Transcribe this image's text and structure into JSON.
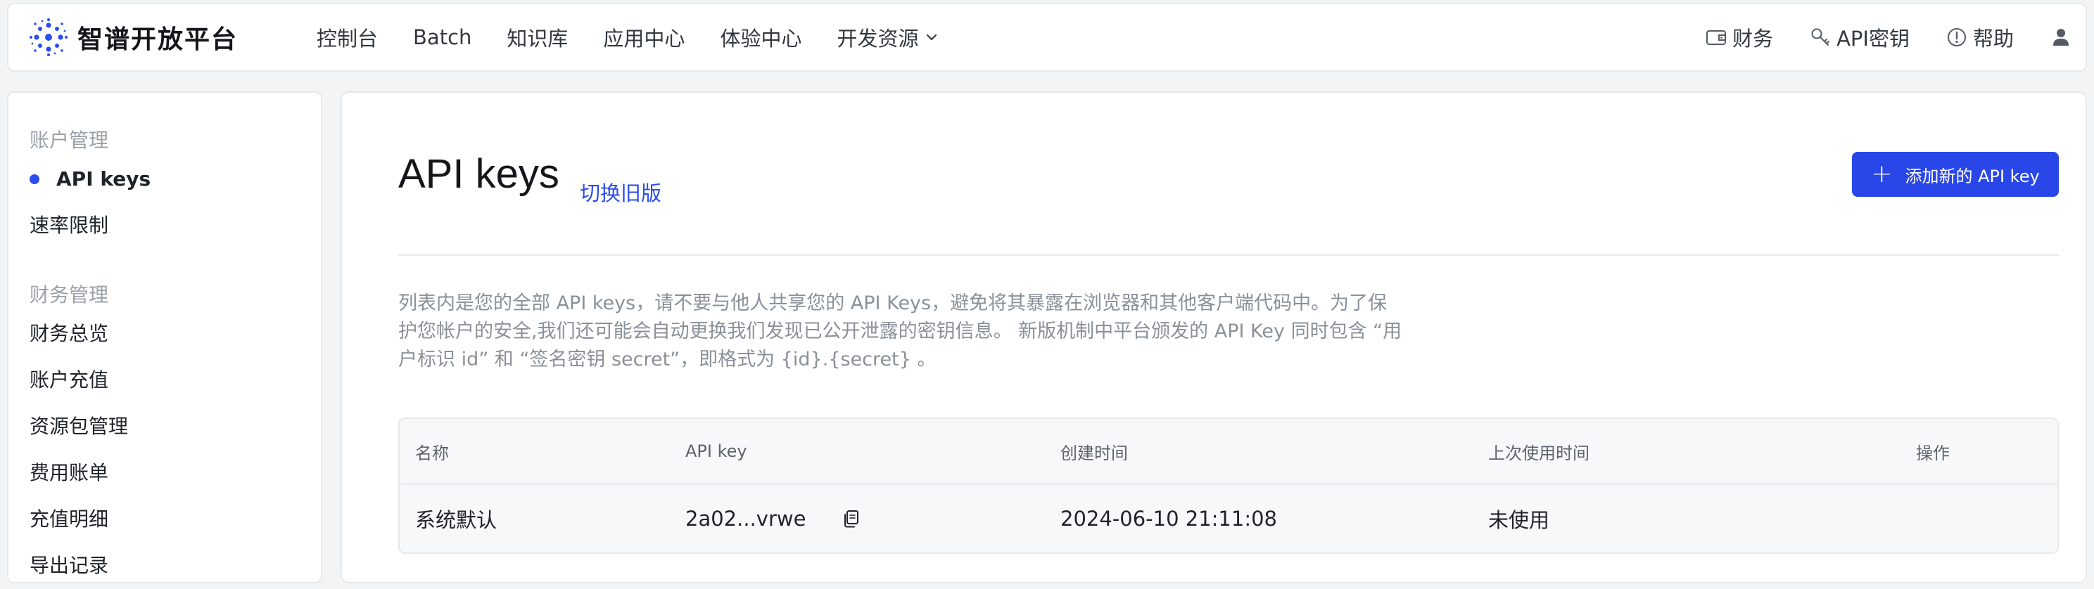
{
  "header": {
    "brand_name": "智谱开放平台",
    "nav": [
      {
        "label": "控制台"
      },
      {
        "label": "Batch"
      },
      {
        "label": "知识库"
      },
      {
        "label": "应用中心"
      },
      {
        "label": "体验中心"
      },
      {
        "label": "开发资源",
        "has_dropdown": true
      }
    ],
    "right": [
      {
        "label": "财务",
        "icon": "wallet-icon"
      },
      {
        "label": "API密钥",
        "icon": "key-icon"
      },
      {
        "label": "帮助",
        "icon": "help-icon"
      }
    ],
    "user_icon": "user-icon"
  },
  "sidebar": {
    "sections": [
      {
        "title": "账户管理",
        "items": [
          {
            "label": "API keys",
            "active": true
          },
          {
            "label": "速率限制",
            "active": false
          }
        ]
      },
      {
        "title": "财务管理",
        "items": [
          {
            "label": "财务总览"
          },
          {
            "label": "账户充值"
          },
          {
            "label": "资源包管理"
          },
          {
            "label": "费用账单"
          },
          {
            "label": "充值明细"
          },
          {
            "label": "导出记录"
          }
        ]
      }
    ]
  },
  "main": {
    "title": "API keys",
    "switch_link": "切换旧版",
    "add_button": "添加新的 API key",
    "description_lines": [
      "列表内是您的全部 API keys，请不要与他人共享您的 API Keys，避免将其暴露在浏览器和其他客户端代码中。为了保",
      "护您帐户的安全,我们还可能会自动更换我们发现已公开泄露的密钥信息。 新版机制中平台颁发的 API Key 同时包含 “用",
      "户标识 id” 和 “签名密钥 secret”，即格式为 {id}.{secret} 。"
    ],
    "table": {
      "columns": [
        "名称",
        "API key",
        "创建时间",
        "上次使用时间",
        "操作"
      ],
      "rows": [
        {
          "name": "系统默认",
          "api_key": "2a02...vrwe",
          "created": "2024-06-10 21:11:08",
          "last_used": "未使用",
          "action": ""
        }
      ]
    }
  },
  "colors": {
    "accent": "#2947e8",
    "link": "#2b4cf0",
    "background": "#f3f4f6"
  }
}
